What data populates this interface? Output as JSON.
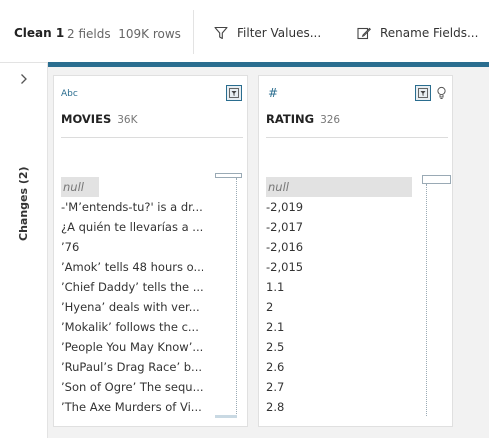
{
  "step": {
    "name": "Clean 1",
    "fields": "2 fields",
    "rows": "109K rows"
  },
  "toolbar": {
    "filter_label": "Filter Values...",
    "rename_label": "Rename Fields..."
  },
  "rail": {
    "changes_label": "Changes (2)"
  },
  "fields": [
    {
      "type": "Abc",
      "name": "MOVIES",
      "count": "36K",
      "values": [
        "null",
        "-'M’entends-tu?' is a dr...",
        "¿A quién te llevarías a ...",
        "’76",
        "’Amok’ tells 48 hours o...",
        "’Chief Daddy’ tells the ...",
        "’Hyena’ deals with ver...",
        "’Mokalik’ follows the c...",
        "’People You May Know’...",
        "’RuPaul’s Drag Race’ b...",
        "’Son of Ogre’ The sequ...",
        "’The Axe Murders of Vi..."
      ]
    },
    {
      "type": "#",
      "name": "RATING",
      "count": "326",
      "values": [
        "null",
        "-2,019",
        "-2,017",
        "-2,016",
        "-2,015",
        "1.1",
        "2",
        "2.1",
        "2.5",
        "2.6",
        "2.7",
        "2.8"
      ]
    }
  ],
  "colors": {
    "accent": "#2a6d8f",
    "canvas": "#f2f2f2",
    "null_bg": "#e2e2e2"
  }
}
